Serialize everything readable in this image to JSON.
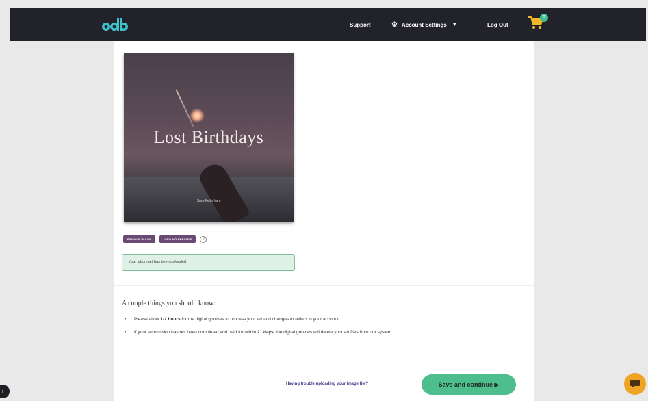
{
  "header": {
    "logo_text": "cdb",
    "nav": {
      "support": "Support",
      "account_settings": "Account Settings",
      "log_out": "Log Out"
    },
    "cart_count": "0"
  },
  "cover": {
    "title": "Lost Birthdays",
    "artist": "Sara Fetterham"
  },
  "actions": {
    "remove_image": "REMOVE IMAGE",
    "view_hd_preview": "VIEW HD PREVIEW",
    "help": "?"
  },
  "alert": {
    "message": "Your album art has been uploaded"
  },
  "info": {
    "heading": "A couple things you should know:",
    "item1_pre": "Please allow ",
    "item1_bold": "1-2 hours",
    "item1_post": " for the digital gnomes to process your art and changes to reflect in your account.",
    "item2_pre": "If your submission has not been completed and paid for within ",
    "item2_bold": "21 days",
    "item2_post": ", the digital gnomes will delete your art files from our system."
  },
  "footer": {
    "trouble_link": "Having trouble uploading your image file?",
    "save_button": "Save and continue ▶"
  },
  "widgets": {
    "left_widget": "i"
  },
  "colors": {
    "topbar": "#22222b",
    "accent_green": "#4ebf8c",
    "pill_purple": "#6a4a72",
    "chat_orange": "#f0a423"
  }
}
